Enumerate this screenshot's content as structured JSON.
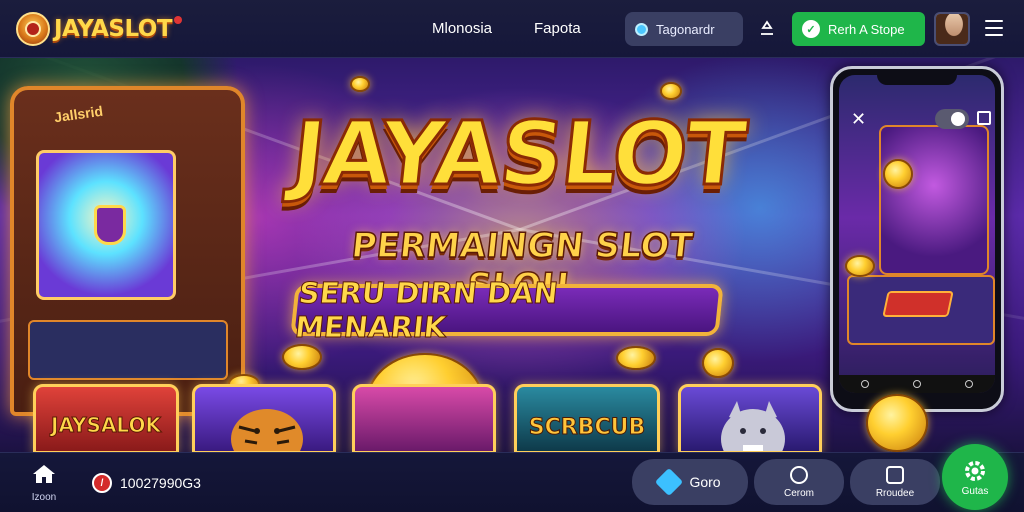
{
  "brand": {
    "name": "JAYASLOT"
  },
  "nav": {
    "links": [
      "Mlonosia",
      "Fapota"
    ],
    "search_label": "Tagonardr",
    "cta_label": "Rerh A Stope"
  },
  "hero": {
    "title": "JAYASLOT",
    "subtitle": "PERMAINGN SLOT SLOU",
    "ribbon": "SERU DIRN DAN MENARIK",
    "arcade_title": "Jallsrid"
  },
  "games": [
    {
      "label": "JAYSALOK",
      "color": "#d72a2a"
    },
    {
      "label": "",
      "color": "#6a3ad6"
    },
    {
      "label": "",
      "color": "#c23a8a"
    },
    {
      "label": "SCRBCUB",
      "color": "#1a5a6a"
    },
    {
      "label": "",
      "color": "#5a3ac6"
    }
  ],
  "bottom": {
    "home_label": "Izoon",
    "phone": "10027990G3",
    "btn1": "Goro",
    "btn2": "Cerom",
    "btn3": "Rroudee",
    "fab": "Gutas"
  },
  "colors": {
    "accent_green": "#1fb64a",
    "gold": "#ffd84a",
    "nav_bg": "#1b1d3d"
  }
}
